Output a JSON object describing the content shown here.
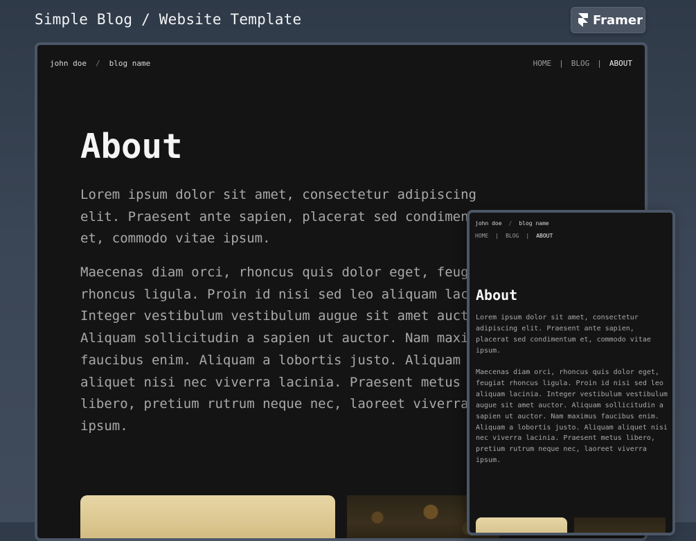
{
  "header": {
    "title": "Simple Blog / Website Template",
    "badge_label": "Framer"
  },
  "nav": {
    "author": "john doe",
    "separator": "/",
    "blog_name": "blog name",
    "link_separator": "|",
    "links": [
      "HOME",
      "BLOG",
      "ABOUT"
    ],
    "active_link": "ABOUT"
  },
  "about": {
    "title": "About",
    "paragraphs": [
      "Lorem ipsum dolor sit amet, consectetur adipiscing elit. Praesent ante sapien, placerat sed condimentum et, commodo vitae ipsum.",
      "Maecenas diam orci, rhoncus quis dolor eget, feugiat rhoncus ligula. Proin id nisi sed leo aliquam lacinia. Integer vestibulum vestibulum augue sit amet auctor. Aliquam sollicitudin a sapien ut auctor. Nam maximus faucibus enim. Aliquam a lobortis justo. Aliquam aliquet nisi nec viverra lacinia. Praesent metus libero, pretium rutrum neque nec, laoreet viverra ipsum."
    ]
  },
  "colors": {
    "background": "#141414",
    "heading": "#f5f5f5",
    "body_text": "#a9a9a9",
    "frame_border": "#4b5666"
  },
  "icons": {
    "brand": "framer-logo-icon"
  }
}
